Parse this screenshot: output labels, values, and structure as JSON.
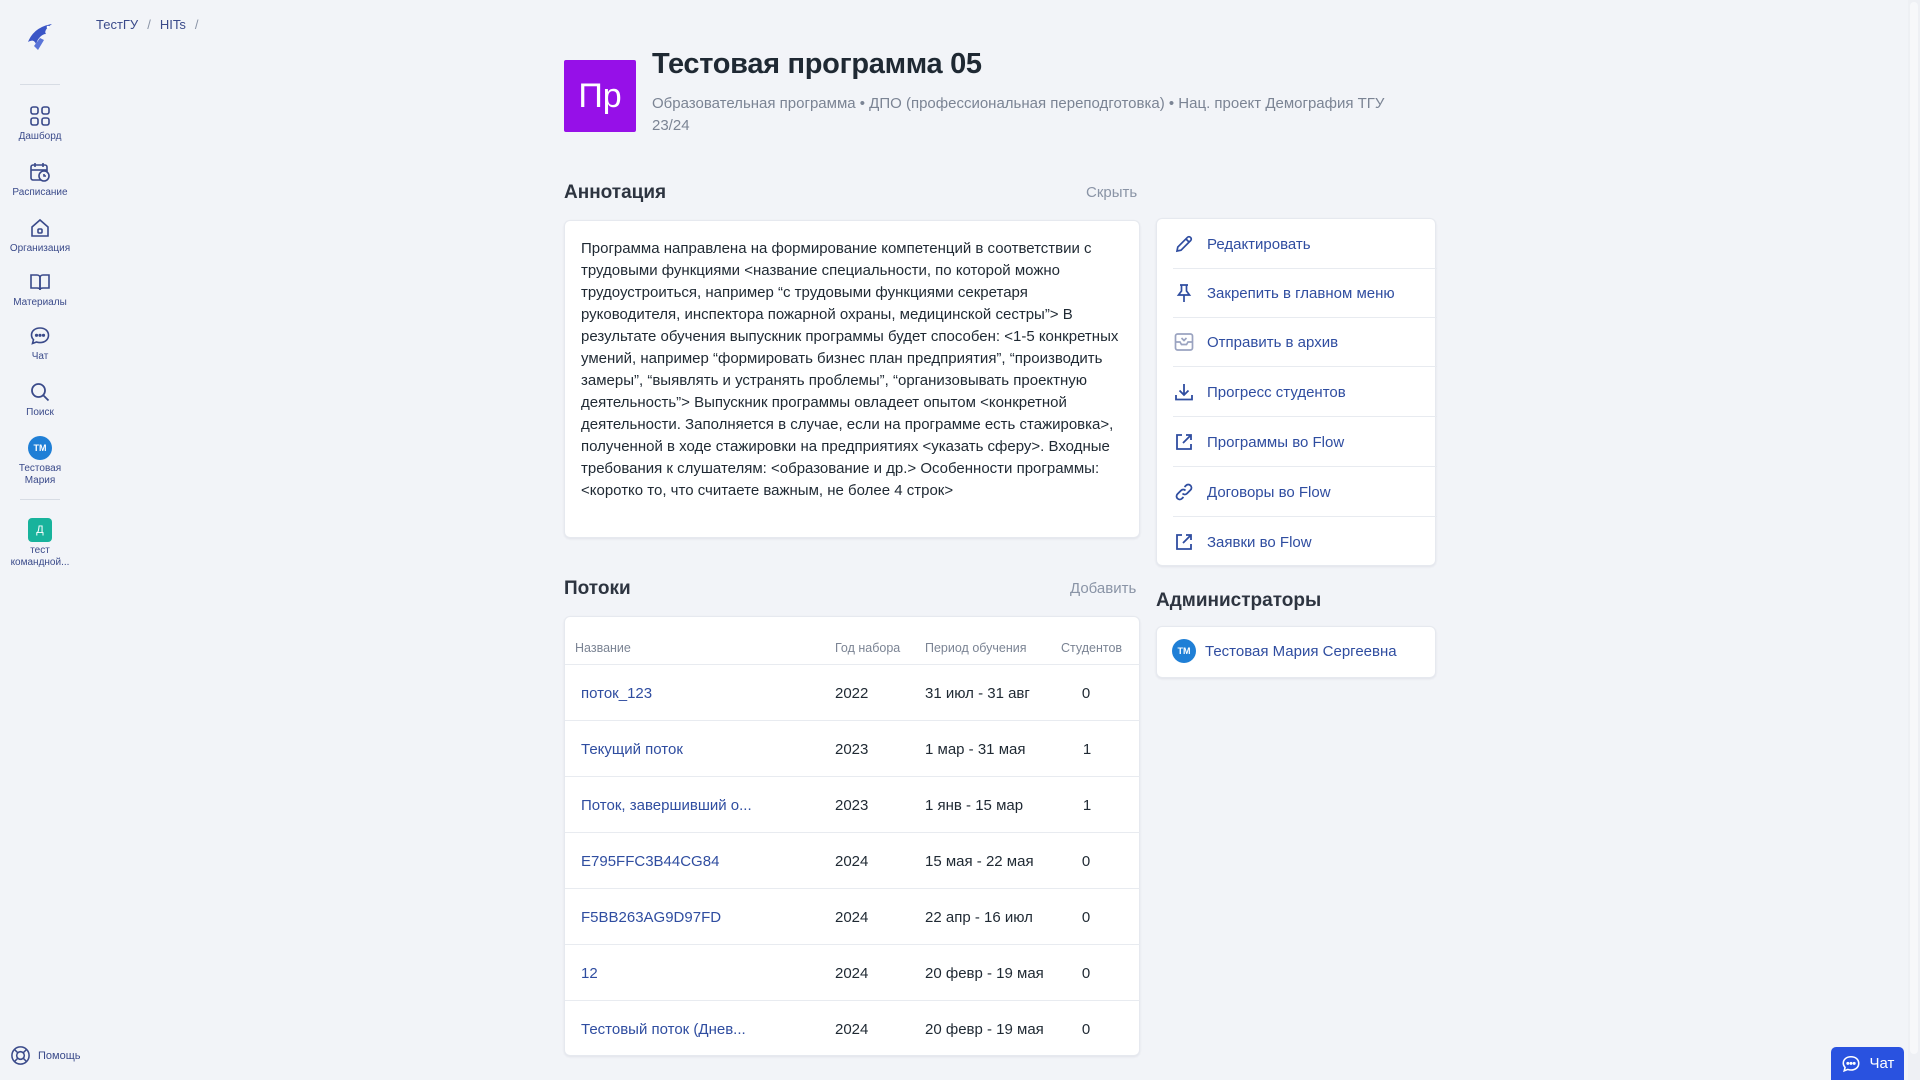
{
  "sidebar": {
    "items": [
      {
        "label": "Дашборд",
        "icon": "dashboard-icon"
      },
      {
        "label": "Расписание",
        "icon": "schedule-icon"
      },
      {
        "label": "Организация",
        "icon": "organization-icon"
      },
      {
        "label": "Материалы",
        "icon": "materials-icon"
      },
      {
        "label": "Чат",
        "icon": "chat-icon"
      },
      {
        "label": "Поиск",
        "icon": "search-icon"
      }
    ],
    "profile": {
      "initials": "ТМ",
      "label": "Тестовая Мария"
    },
    "team": {
      "initial": "Д",
      "label": "тест командной..."
    },
    "help_label": "Помощь"
  },
  "breadcrumb": [
    "ТестГУ",
    "HITs"
  ],
  "program": {
    "logo_text": "Пр",
    "title": "Тестовая программа 05",
    "subtitle": "Образовательная программа • ДПО (профессиональная переподготовка) • Нац. проект Демография ТГУ 23/24"
  },
  "annotation": {
    "title": "Аннотация",
    "hide_label": "Скрыть",
    "text": "Программа направлена на формирование компетенций в соответствии с трудовыми функциями <название специальности, по которой можно трудоустроиться, например “с трудовыми функциями секретаря руководителя, инспектора пожарной охраны, медицинской сестры”> В результате обучения выпускник программы будет способен: <1-5 конкретных умений, например “формировать бизнес план предприятия”, “производить замеры”, “выявлять и устранять проблемы”, “организовывать проектную деятельность”> Выпускник программы овладеет опытом <конкретной деятельности. Заполняется в случае, если на программе есть стажировка>, полученной в ходе стажировки на предприятиях <указать сферу>. Входные требования к слушателям: <образование и др.> Особенности программы: <коротко то, что считаете важным, не более 4 строк>"
  },
  "streams": {
    "title": "Потоки",
    "add_label": "Добавить",
    "columns": [
      "Название",
      "Год набора",
      "Период обучения",
      "Студентов"
    ],
    "rows": [
      {
        "name": "поток_123",
        "year": "2022",
        "period": "31 июл - 31 авг",
        "students": "0"
      },
      {
        "name": "Текущий поток",
        "year": "2023",
        "period": "1 мар - 31 мая",
        "students": "1"
      },
      {
        "name": "Поток, завершивший о...",
        "year": "2023",
        "period": "1 янв - 15 мар",
        "students": "1"
      },
      {
        "name": "E795FFC3B44CG84",
        "year": "2024",
        "period": "15 мая - 22 мая",
        "students": "0"
      },
      {
        "name": "F5BB263AG9D97FD",
        "year": "2024",
        "period": "22 апр - 16 июл",
        "students": "0"
      },
      {
        "name": "12",
        "year": "2024",
        "period": "20 февр - 19 мая",
        "students": "0"
      },
      {
        "name": "Тестовый поток (Днев...",
        "year": "2024",
        "period": "20 февр - 19 мая",
        "students": "0"
      }
    ]
  },
  "actions": [
    {
      "label": "Редактировать",
      "icon": "pencil-icon"
    },
    {
      "label": "Закрепить в главном меню",
      "icon": "pin-icon"
    },
    {
      "label": "Отправить в архив",
      "icon": "archive-icon"
    },
    {
      "label": "Прогресс студентов",
      "icon": "download-icon"
    },
    {
      "label": "Программы во Flow",
      "icon": "external-link-icon"
    },
    {
      "label": "Договоры во Flow",
      "icon": "link-icon"
    },
    {
      "label": "Заявки во Flow",
      "icon": "external-link-icon"
    }
  ],
  "admins": {
    "title": "Администраторы",
    "list": [
      {
        "initials": "ТМ",
        "name": "Тестовая Мария Сергеевна"
      }
    ]
  },
  "chat_button": {
    "label": "Чат"
  },
  "colors": {
    "accent": "#2952e0",
    "program_logo": "#9610e8",
    "link": "#2f4da0",
    "avatar": "#1f7fd6",
    "team": "#18b39c"
  }
}
